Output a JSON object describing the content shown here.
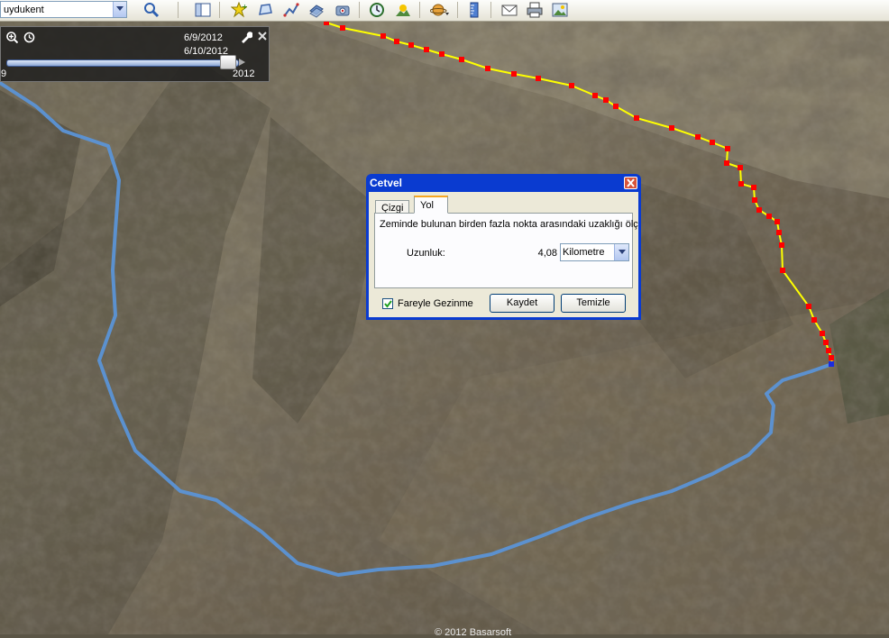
{
  "toolbar": {
    "search_value": "uydukent"
  },
  "time_slider": {
    "start_date": "6/9/2012",
    "end_date": "6/10/2012",
    "left_year": "9",
    "right_year": "2012"
  },
  "ruler_dialog": {
    "title": "Cetvel",
    "tabs": [
      {
        "label": "Çizgi",
        "active": false
      },
      {
        "label": "Yol",
        "active": true
      }
    ],
    "description": "Zeminde bulunan birden fazla nokta arasındaki uzaklığı ölç",
    "length_label": "Uzunluk:",
    "length_value": "4,08",
    "unit_selected": "Kilometre",
    "mouse_nav_label": "Fareyle Gezinme",
    "mouse_nav_checked": true,
    "save_label": "Kaydet",
    "clear_label": "Temizle"
  },
  "map": {
    "copyright": "© 2012 Basarsoft",
    "path_color": "#ffff00",
    "path_point_color": "#ff0000",
    "route_color": "#5b93d6"
  }
}
